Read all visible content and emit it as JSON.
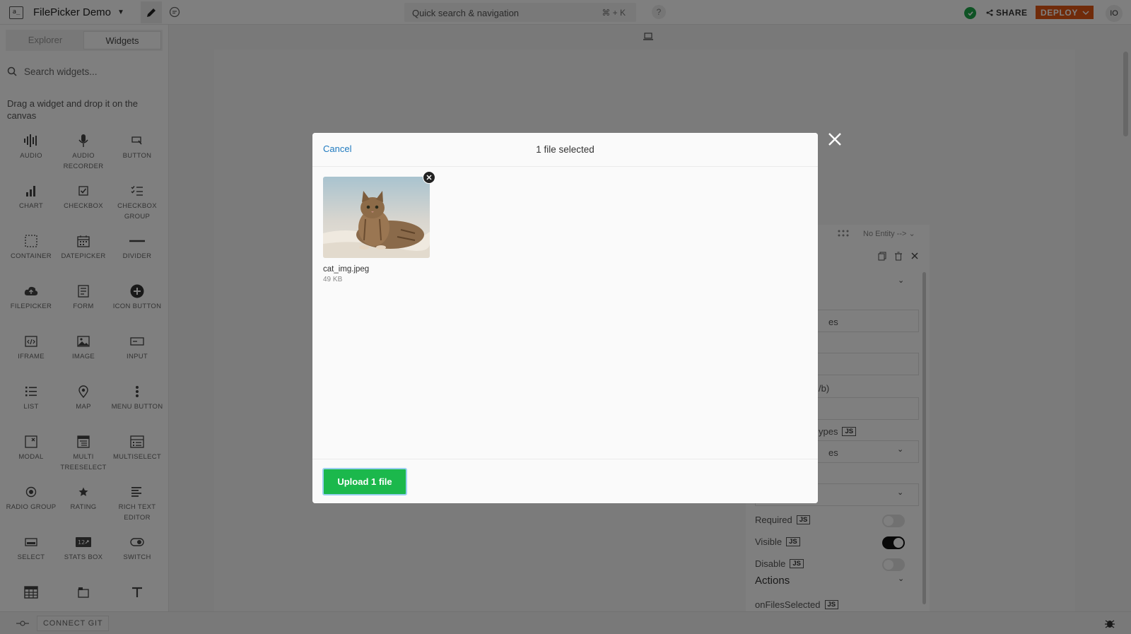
{
  "topbar": {
    "logo_text": "a_",
    "app_name": "FilePicker Demo",
    "search_label": "Quick search & navigation",
    "search_shortcut": "⌘ + K",
    "help": "?",
    "share_label": "SHARE",
    "deploy_label": "DEPLOY",
    "avatar_initials": "IO",
    "accent": "#e15615",
    "status_color": "#1ea74a"
  },
  "sidebar": {
    "tabs": [
      {
        "label": "Explorer",
        "active": false
      },
      {
        "label": "Widgets",
        "active": true
      }
    ],
    "search_placeholder": "Search widgets...",
    "hint": "Drag a widget and drop it on the canvas",
    "widgets": [
      {
        "label": "AUDIO",
        "icon": "audio-icon"
      },
      {
        "label": "AUDIO RECORDER",
        "icon": "microphone-icon"
      },
      {
        "label": "BUTTON",
        "icon": "button-icon"
      },
      {
        "label": "CHART",
        "icon": "chart-icon"
      },
      {
        "label": "CHECKBOX",
        "icon": "checkbox-icon"
      },
      {
        "label": "CHECKBOX GROUP",
        "icon": "checkbox-group-icon"
      },
      {
        "label": "CONTAINER",
        "icon": "container-icon"
      },
      {
        "label": "DATEPICKER",
        "icon": "calendar-icon"
      },
      {
        "label": "DIVIDER",
        "icon": "divider-icon"
      },
      {
        "label": "FILEPICKER",
        "icon": "cloud-upload-icon"
      },
      {
        "label": "FORM",
        "icon": "form-icon"
      },
      {
        "label": "ICON BUTTON",
        "icon": "plus-circle-icon"
      },
      {
        "label": "IFRAME",
        "icon": "iframe-icon"
      },
      {
        "label": "IMAGE",
        "icon": "image-icon"
      },
      {
        "label": "INPUT",
        "icon": "input-icon"
      },
      {
        "label": "LIST",
        "icon": "list-icon"
      },
      {
        "label": "MAP",
        "icon": "map-pin-icon"
      },
      {
        "label": "MENU BUTTON",
        "icon": "kebab-menu-icon"
      },
      {
        "label": "MODAL",
        "icon": "modal-icon"
      },
      {
        "label": "MULTI TREESELECT",
        "icon": "tree-select-icon"
      },
      {
        "label": "MULTISELECT",
        "icon": "multiselect-icon"
      },
      {
        "label": "RADIO GROUP",
        "icon": "radio-icon"
      },
      {
        "label": "RATING",
        "icon": "star-icon"
      },
      {
        "label": "RICH TEXT EDITOR",
        "icon": "rich-text-icon"
      },
      {
        "label": "SELECT",
        "icon": "select-icon"
      },
      {
        "label": "STATS BOX",
        "icon": "stats-box-icon"
      },
      {
        "label": "SWITCH",
        "icon": "switch-icon"
      },
      {
        "label": "",
        "icon": "table-icon"
      },
      {
        "label": "",
        "icon": "tabs-icon"
      },
      {
        "label": "",
        "icon": "text-icon"
      }
    ]
  },
  "bottombar": {
    "connect_git": "CONNECT GIT"
  },
  "property_pane": {
    "entity_label": "No Entity --> ⌄",
    "partial_1": "es",
    "partial_2": "/b)",
    "partial_3": "ypes",
    "partial_4": "es",
    "rows": [
      {
        "label": "Required",
        "on": false
      },
      {
        "label": "Visible",
        "on": true
      },
      {
        "label": "Disable",
        "on": false
      }
    ],
    "js_badge": "JS",
    "actions_label": "Actions",
    "on_files_selected": "onFilesSelected"
  },
  "modal": {
    "cancel": "Cancel",
    "title": "1 file selected",
    "file": {
      "name": "cat_img.jpeg",
      "size": "49 KB"
    },
    "upload_label": "Upload 1 file",
    "upload_color": "#1bb84c"
  }
}
